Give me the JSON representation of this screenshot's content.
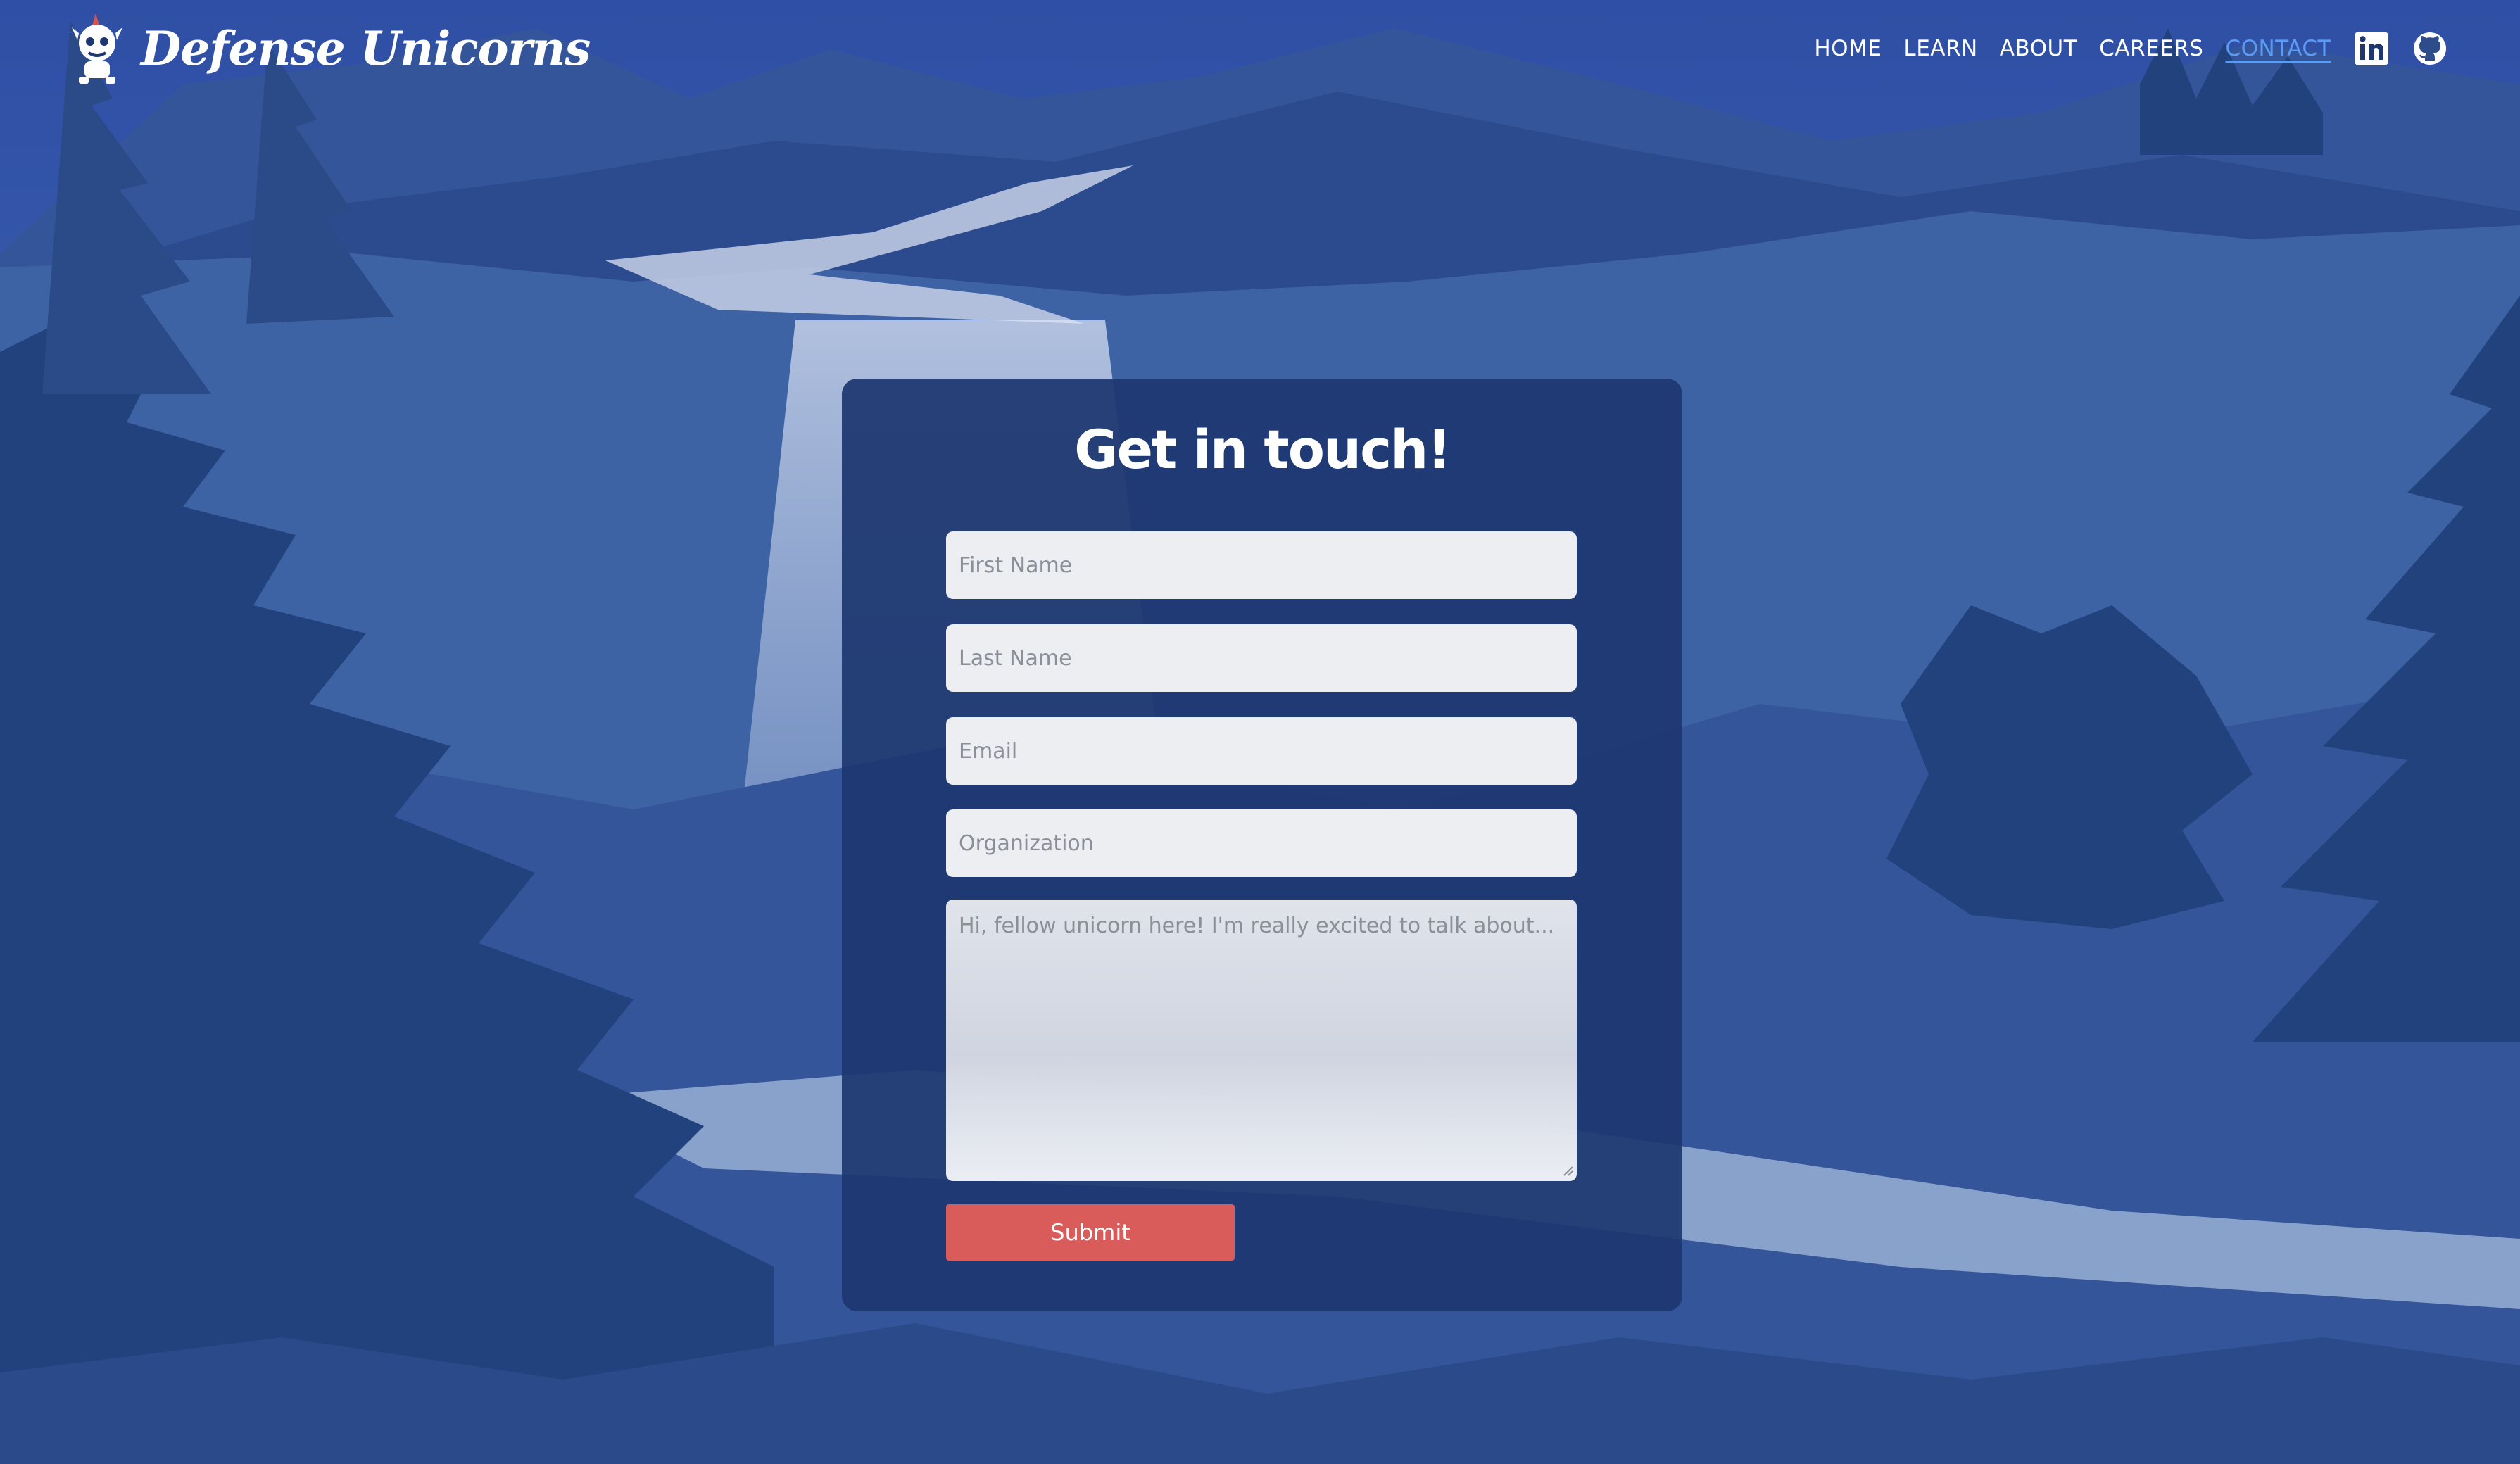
{
  "brand": {
    "name": "Defense Unicorns",
    "logo_icon": "unicorn-mascot-icon"
  },
  "nav": {
    "items": [
      {
        "label": "HOME"
      },
      {
        "label": "LEARN"
      },
      {
        "label": "ABOUT"
      },
      {
        "label": "CAREERS"
      },
      {
        "label": "CONTACT",
        "active": true
      }
    ],
    "social": [
      {
        "icon": "linkedin-icon"
      },
      {
        "icon": "github-icon"
      }
    ],
    "active_color": "#5b9bf3"
  },
  "form": {
    "title": "Get in touch!",
    "first_name": {
      "placeholder": "First Name",
      "value": ""
    },
    "last_name": {
      "placeholder": "Last Name",
      "value": ""
    },
    "email": {
      "placeholder": "Email",
      "value": ""
    },
    "organization": {
      "placeholder": "Organization",
      "value": ""
    },
    "message": {
      "placeholder": "Hi, fellow unicorn here! I'm really excited to talk about...",
      "value": ""
    },
    "submit_label": "Submit"
  },
  "colors": {
    "card_bg": "#1d3770",
    "submit_bg": "#d95b5a",
    "sky_top": "#2f4fa6",
    "forest_dark": "#22427d"
  }
}
